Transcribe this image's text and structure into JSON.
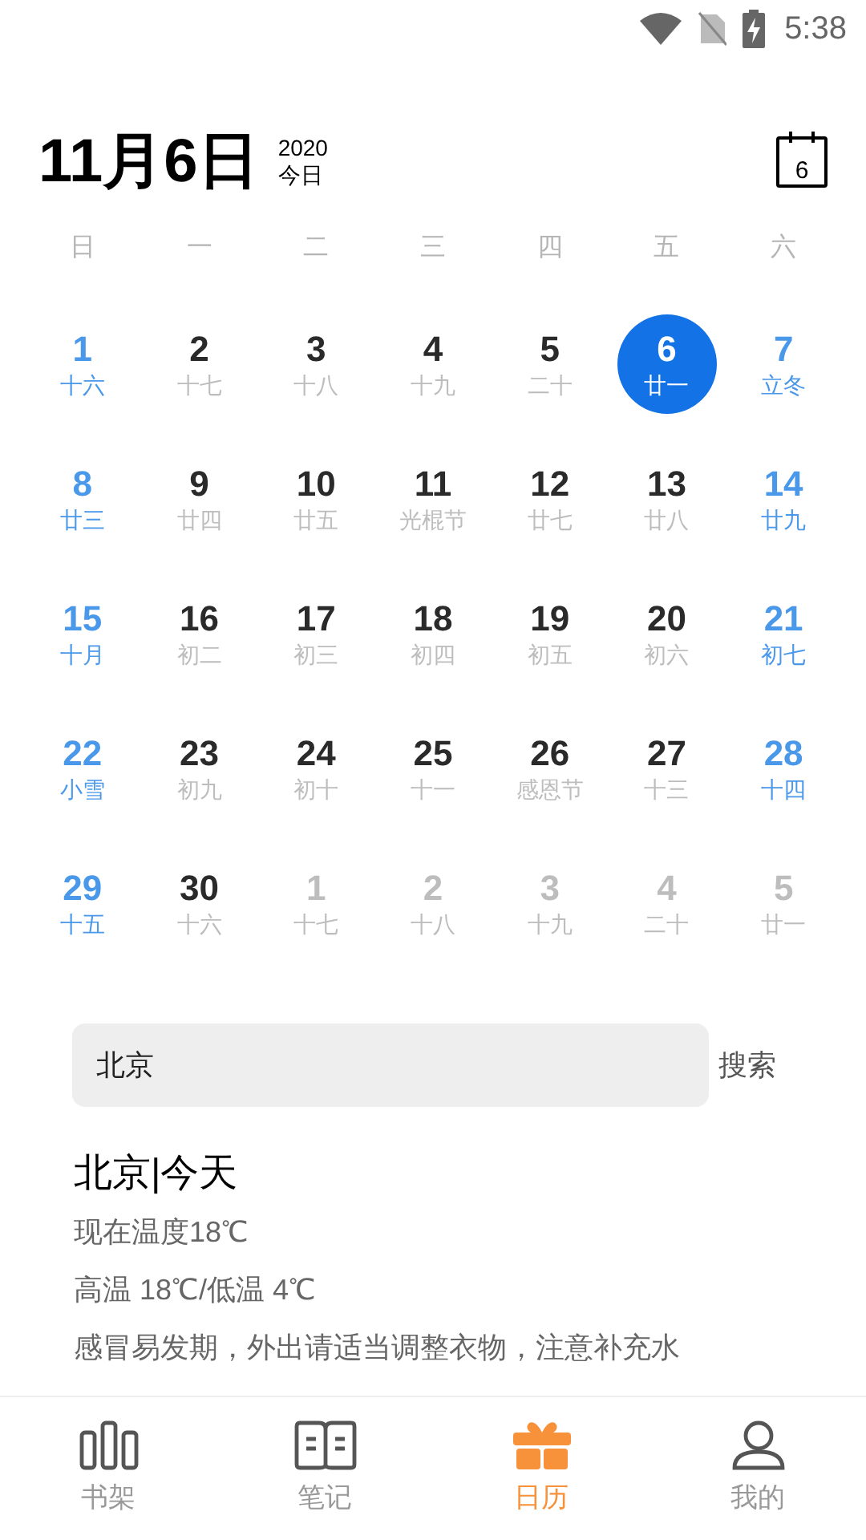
{
  "status_bar": {
    "time": "5:38"
  },
  "header": {
    "date": "11月6日",
    "year": "2020",
    "today_label": "今日",
    "calendar_button_day": "6"
  },
  "weekdays": [
    "日",
    "一",
    "二",
    "三",
    "四",
    "五",
    "六"
  ],
  "days": [
    {
      "day": "1",
      "lunar": "十六",
      "kind": "weekend",
      "selected": false
    },
    {
      "day": "2",
      "lunar": "十七",
      "kind": "weekday",
      "selected": false
    },
    {
      "day": "3",
      "lunar": "十八",
      "kind": "weekday",
      "selected": false
    },
    {
      "day": "4",
      "lunar": "十九",
      "kind": "weekday",
      "selected": false
    },
    {
      "day": "5",
      "lunar": "二十",
      "kind": "weekday",
      "selected": false
    },
    {
      "day": "6",
      "lunar": "廿一",
      "kind": "weekday",
      "selected": true
    },
    {
      "day": "7",
      "lunar": "立冬",
      "kind": "weekend",
      "selected": false
    },
    {
      "day": "8",
      "lunar": "廿三",
      "kind": "weekend",
      "selected": false
    },
    {
      "day": "9",
      "lunar": "廿四",
      "kind": "weekday",
      "selected": false
    },
    {
      "day": "10",
      "lunar": "廿五",
      "kind": "weekday",
      "selected": false
    },
    {
      "day": "11",
      "lunar": "光棍节",
      "kind": "weekday",
      "selected": false
    },
    {
      "day": "12",
      "lunar": "廿七",
      "kind": "weekday",
      "selected": false
    },
    {
      "day": "13",
      "lunar": "廿八",
      "kind": "weekday",
      "selected": false
    },
    {
      "day": "14",
      "lunar": "廿九",
      "kind": "weekend",
      "selected": false
    },
    {
      "day": "15",
      "lunar": "十月",
      "kind": "weekend",
      "selected": false
    },
    {
      "day": "16",
      "lunar": "初二",
      "kind": "weekday",
      "selected": false
    },
    {
      "day": "17",
      "lunar": "初三",
      "kind": "weekday",
      "selected": false
    },
    {
      "day": "18",
      "lunar": "初四",
      "kind": "weekday",
      "selected": false
    },
    {
      "day": "19",
      "lunar": "初五",
      "kind": "weekday",
      "selected": false
    },
    {
      "day": "20",
      "lunar": "初六",
      "kind": "weekday",
      "selected": false
    },
    {
      "day": "21",
      "lunar": "初七",
      "kind": "weekend",
      "selected": false
    },
    {
      "day": "22",
      "lunar": "小雪",
      "kind": "weekend",
      "selected": false
    },
    {
      "day": "23",
      "lunar": "初九",
      "kind": "weekday",
      "selected": false
    },
    {
      "day": "24",
      "lunar": "初十",
      "kind": "weekday",
      "selected": false
    },
    {
      "day": "25",
      "lunar": "十一",
      "kind": "weekday",
      "selected": false
    },
    {
      "day": "26",
      "lunar": "感恩节",
      "kind": "weekday",
      "selected": false
    },
    {
      "day": "27",
      "lunar": "十三",
      "kind": "weekday",
      "selected": false
    },
    {
      "day": "28",
      "lunar": "十四",
      "kind": "weekend",
      "selected": false
    },
    {
      "day": "29",
      "lunar": "十五",
      "kind": "weekend",
      "selected": false
    },
    {
      "day": "30",
      "lunar": "十六",
      "kind": "weekday",
      "selected": false
    },
    {
      "day": "1",
      "lunar": "十七",
      "kind": "other",
      "selected": false
    },
    {
      "day": "2",
      "lunar": "十八",
      "kind": "other",
      "selected": false
    },
    {
      "day": "3",
      "lunar": "十九",
      "kind": "other",
      "selected": false
    },
    {
      "day": "4",
      "lunar": "二十",
      "kind": "other",
      "selected": false
    },
    {
      "day": "5",
      "lunar": "廿一",
      "kind": "other",
      "selected": false
    }
  ],
  "search": {
    "value": "北京",
    "button": "搜索"
  },
  "weather": {
    "title": "北京|今天",
    "lines": [
      "现在温度18℃",
      "高温 18℃/低温 4℃",
      "感冒易发期，外出请适当调整衣物，注意补充水"
    ]
  },
  "tabs": [
    {
      "label": "书架",
      "kind": "shelf",
      "selected": false
    },
    {
      "label": "笔记",
      "kind": "notes",
      "selected": false
    },
    {
      "label": "日历",
      "kind": "calendar",
      "selected": true
    },
    {
      "label": "我的",
      "kind": "profile",
      "selected": false
    }
  ]
}
